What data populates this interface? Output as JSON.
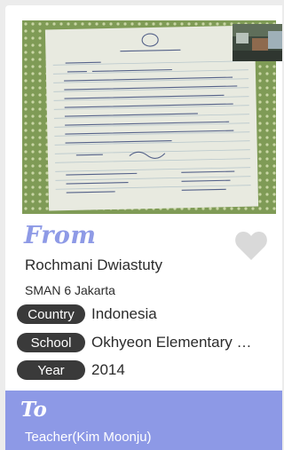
{
  "card": {
    "photo": {
      "icon": "letter-photo",
      "alt_colors": {
        "border": "#7e9a55",
        "paper": "#e9ebe0"
      }
    },
    "from_label": "From",
    "sender": {
      "name": "Rochmani Dwiastuty",
      "school": "SMAN 6 Jakarta"
    },
    "details": [
      {
        "label": "Country",
        "value": "Indonesia"
      },
      {
        "label": "School",
        "value": "Okhyeon Elementary School"
      },
      {
        "label": "Year",
        "value": "2014"
      }
    ],
    "favorite_icon": "heart-icon",
    "to": {
      "label": "To",
      "recipient": "Teacher(Kim Moonju)"
    }
  },
  "colors": {
    "accent": "#8d99e6",
    "pill_bg": "#3a3a3a",
    "heart": "#d9d9d9"
  }
}
